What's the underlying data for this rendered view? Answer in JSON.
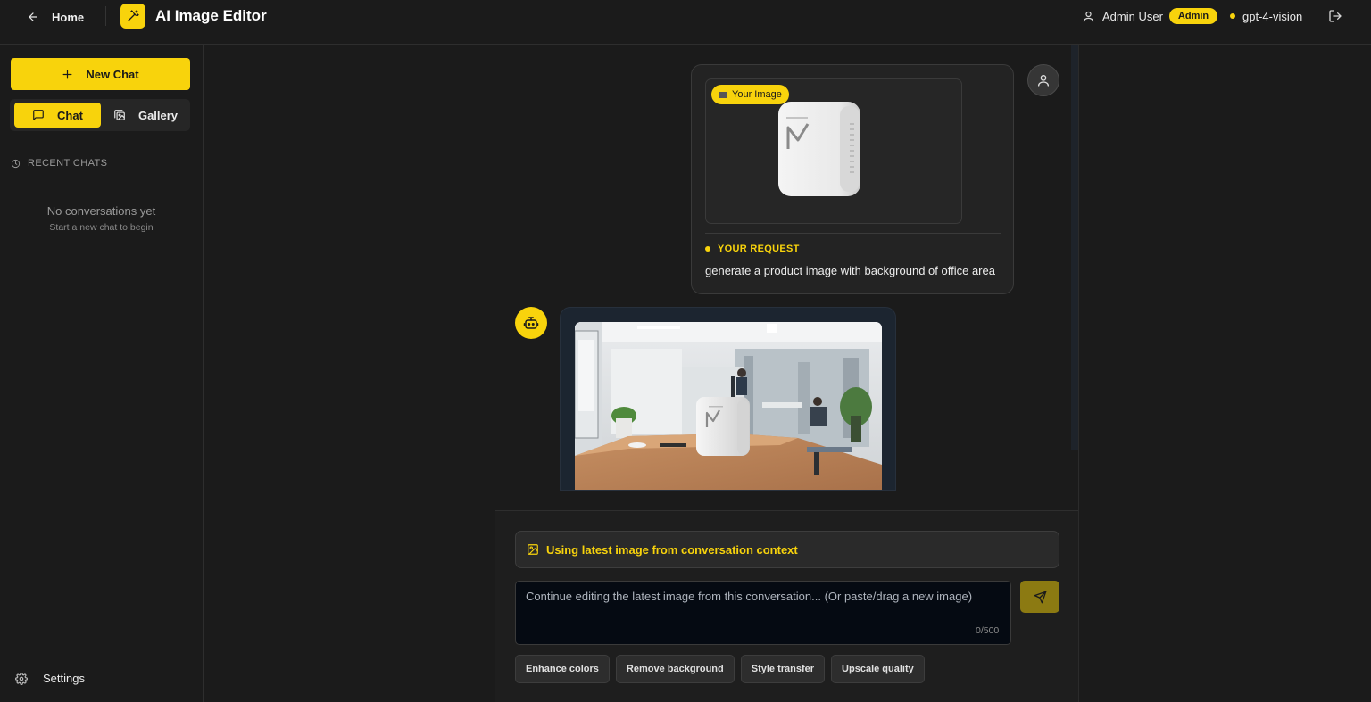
{
  "header": {
    "back_label": "Home",
    "app_title": "AI Image Editor",
    "user_name": "Admin User",
    "role_badge": "Admin",
    "model_name": "gpt-4-vision",
    "accent_color": "#f8d30c"
  },
  "sidebar": {
    "new_chat_label": "New Chat",
    "tabs": [
      {
        "label": "Chat",
        "active": true,
        "icon": "message-square-icon"
      },
      {
        "label": "Gallery",
        "active": false,
        "icon": "images-icon"
      }
    ],
    "recent_header": "RECENT CHATS",
    "empty_title": "No conversations yet",
    "empty_subtitle": "Start a new chat to begin",
    "settings_label": "Settings"
  },
  "conversation": {
    "user_message": {
      "image_tag": "Your Image",
      "request_label": "YOUR REQUEST",
      "request_text": "generate a product image with background of office area"
    },
    "assistant_message": {
      "image_alt": "product on office desk"
    }
  },
  "composer": {
    "context_banner": "Using latest image from conversation context",
    "placeholder": "Continue editing the latest image from this conversation... (Or paste/drag a new image)",
    "char_count": "0/500",
    "quick_actions": [
      "Enhance colors",
      "Remove background",
      "Style transfer",
      "Upscale quality"
    ]
  }
}
